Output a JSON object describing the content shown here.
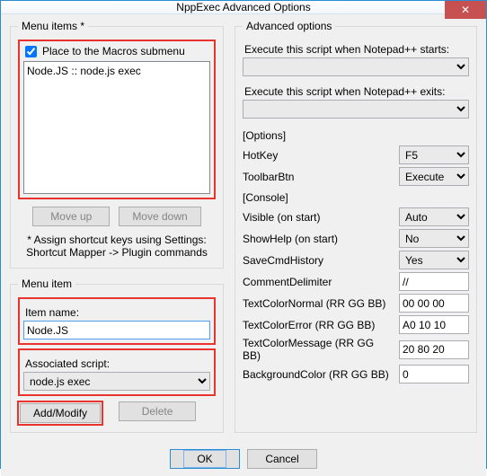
{
  "window": {
    "title": "NppExec Advanced Options",
    "close": "✕"
  },
  "left": {
    "menuitems_legend": "Menu items *",
    "place_macros": "Place to the Macros submenu",
    "place_macros_checked": true,
    "list": [
      "Node.JS :: node.js exec"
    ],
    "moveup": "Move up",
    "movedown": "Move down",
    "hint1": "* Assign shortcut keys using Settings:",
    "hint2": "Shortcut Mapper -> Plugin commands",
    "menuitem_legend": "Menu item",
    "itemname_label": "Item name:",
    "itemname_value": "Node.JS",
    "assoc_label": "Associated script:",
    "assoc_value": "node.js exec",
    "add_modify": "Add/Modify",
    "delete": "Delete"
  },
  "right": {
    "legend": "Advanced options",
    "exec_start_label": "Execute this script when Notepad++ starts:",
    "exec_start_value": "",
    "exec_exit_label": "Execute this script when Notepad++ exits:",
    "exec_exit_value": "",
    "options_head": "[Options]",
    "hotkey_label": "HotKey",
    "hotkey_value": "F5",
    "toolbarbtn_label": "ToolbarBtn",
    "toolbarbtn_value": "Execute",
    "console_head": "[Console]",
    "visible_label": "Visible (on start)",
    "visible_value": "Auto",
    "showhelp_label": "ShowHelp (on start)",
    "showhelp_value": "No",
    "savecmd_label": "SaveCmdHistory",
    "savecmd_value": "Yes",
    "commentdelim_label": "CommentDelimiter",
    "commentdelim_value": "//",
    "tcn_label": "TextColorNormal (RR GG BB)",
    "tcn_value": "00 00 00",
    "tce_label": "TextColorError (RR GG BB)",
    "tce_value": "A0 10 10",
    "tcm_label": "TextColorMessage (RR GG BB)",
    "tcm_value": "20 80 20",
    "bgc_label": "BackgroundColor (RR GG BB)",
    "bgc_value": "0"
  },
  "buttons": {
    "ok": "OK",
    "cancel": "Cancel"
  }
}
